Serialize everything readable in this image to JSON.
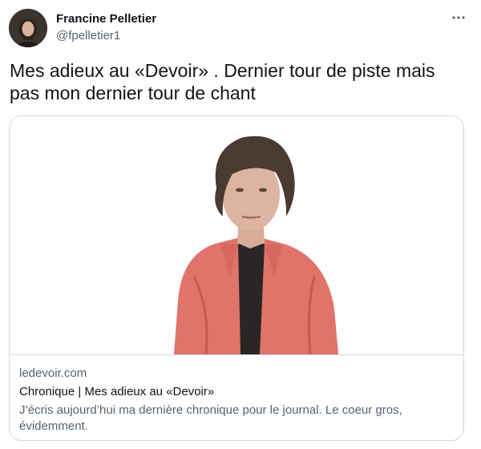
{
  "author": {
    "name": "Francine Pelletier",
    "handle": "@fpelletier1",
    "avatar_icon": "avatar-photo"
  },
  "more_icon": "more-dots-icon",
  "tweet_text": "Mes adieux au «Devoir» . Dernier tour de piste mais pas mon dernier tour de chant",
  "card": {
    "domain": "ledevoir.com",
    "title": "Chronique | Mes adieux au «Devoir»",
    "description": "J’écris aujourd’hui ma dernière chronique pour le journal. Le coeur gros, évidemment.",
    "image_icon": "portrait-photo"
  },
  "colors": {
    "text_primary": "#0f1419",
    "text_secondary": "#536471",
    "border": "#cfd9de",
    "jacket": "#e0736a",
    "hair": "#4a3a30"
  }
}
